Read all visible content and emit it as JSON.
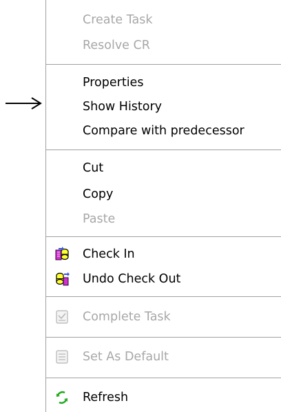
{
  "menu": {
    "items": [
      {
        "label": "Create Task",
        "enabled": false,
        "icon": ""
      },
      {
        "label": "Resolve CR",
        "enabled": false,
        "icon": ""
      },
      {
        "label": "Properties",
        "enabled": true,
        "icon": ""
      },
      {
        "label": "Show History",
        "enabled": true,
        "icon": ""
      },
      {
        "label": "Compare with predecessor",
        "enabled": true,
        "icon": ""
      },
      {
        "label": "Cut",
        "enabled": true,
        "icon": ""
      },
      {
        "label": "Copy",
        "enabled": true,
        "icon": ""
      },
      {
        "label": "Paste",
        "enabled": false,
        "icon": ""
      },
      {
        "label": "Check In",
        "enabled": true,
        "icon": "check-in-icon"
      },
      {
        "label": "Undo Check Out",
        "enabled": true,
        "icon": "undo-check-out-icon"
      },
      {
        "label": "Complete Task",
        "enabled": false,
        "icon": "complete-task-icon"
      },
      {
        "label": "Set As Default",
        "enabled": false,
        "icon": "set-as-default-icon"
      },
      {
        "label": "Refresh",
        "enabled": true,
        "icon": "refresh-icon"
      }
    ]
  },
  "pointer": {
    "icon": "right-arrow-icon",
    "target": "Show History"
  },
  "colors": {
    "text": "#000000",
    "disabled_text": "#a7a7a7",
    "separator": "#a0a0a0",
    "background": "#ffffff"
  }
}
